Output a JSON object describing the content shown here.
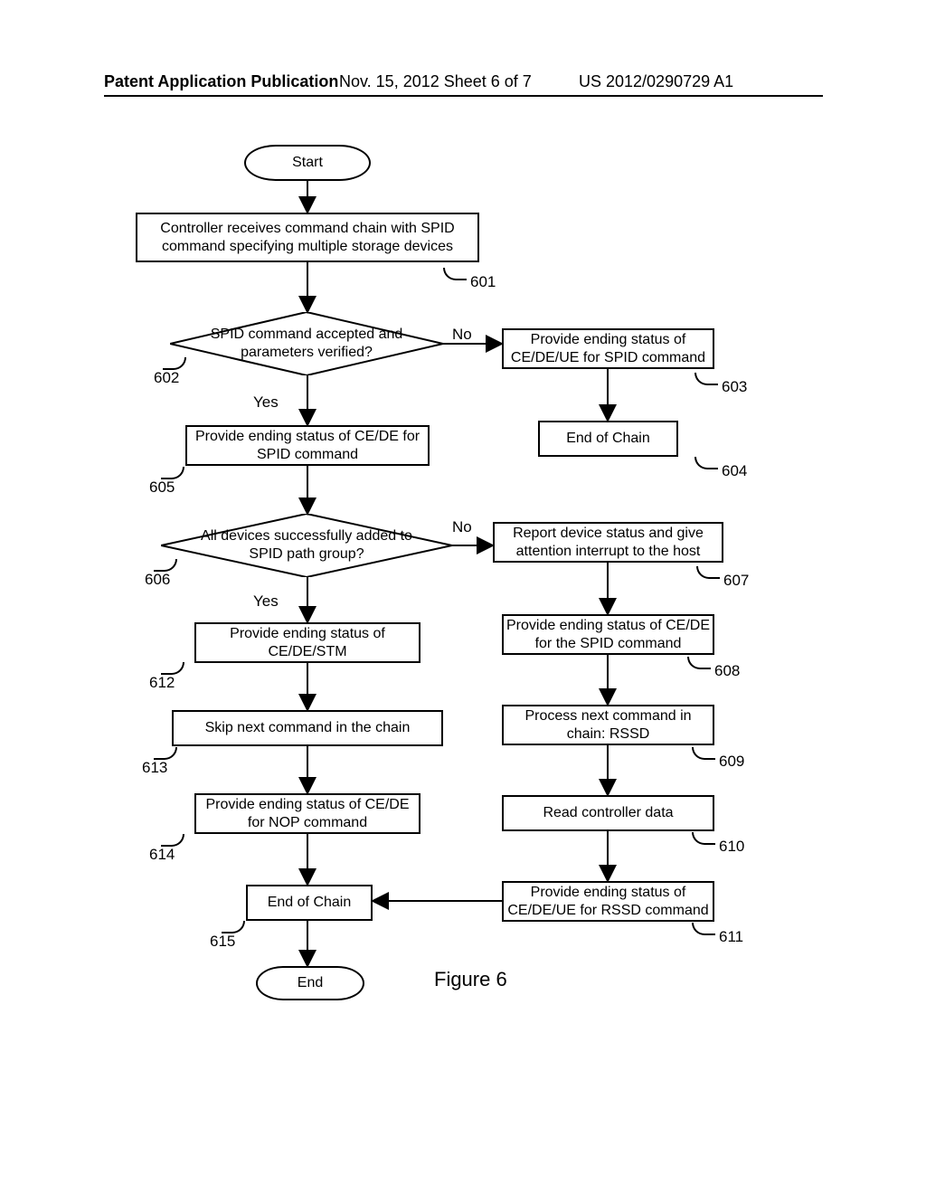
{
  "header": {
    "left": "Patent Application Publication",
    "center": "Nov. 15, 2012   Sheet 6 of 7",
    "right": "US 2012/0290729 A1"
  },
  "nodes": {
    "start": "Start",
    "b601": "Controller receives command chain with SPID command specifying multiple storage devices",
    "d602": "SPID command accepted and parameters verified?",
    "b603": "Provide ending status of CE/DE/UE for SPID command",
    "b604": "End of Chain",
    "b605": "Provide ending status of CE/DE for SPID command",
    "d606": "All devices successfully added to SPID path group?",
    "b607": "Report device status and give attention interrupt to the host",
    "b608": "Provide ending status of CE/DE for the SPID command",
    "b609": "Process next command in chain: RSSD",
    "b610": "Read controller data",
    "b611": "Provide ending status of CE/DE/UE for RSSD command",
    "b612": "Provide ending status of CE/DE/STM",
    "b613": "Skip next command in the chain",
    "b614": "Provide ending status of CE/DE for NOP command",
    "b615": "End of Chain",
    "end": "End"
  },
  "refs": {
    "r601": "601",
    "r602": "602",
    "r603": "603",
    "r604": "604",
    "r605": "605",
    "r606": "606",
    "r607": "607",
    "r608": "608",
    "r609": "609",
    "r610": "610",
    "r611": "611",
    "r612": "612",
    "r613": "613",
    "r614": "614",
    "r615": "615"
  },
  "labels": {
    "yes": "Yes",
    "no": "No"
  },
  "figure": "Figure 6"
}
